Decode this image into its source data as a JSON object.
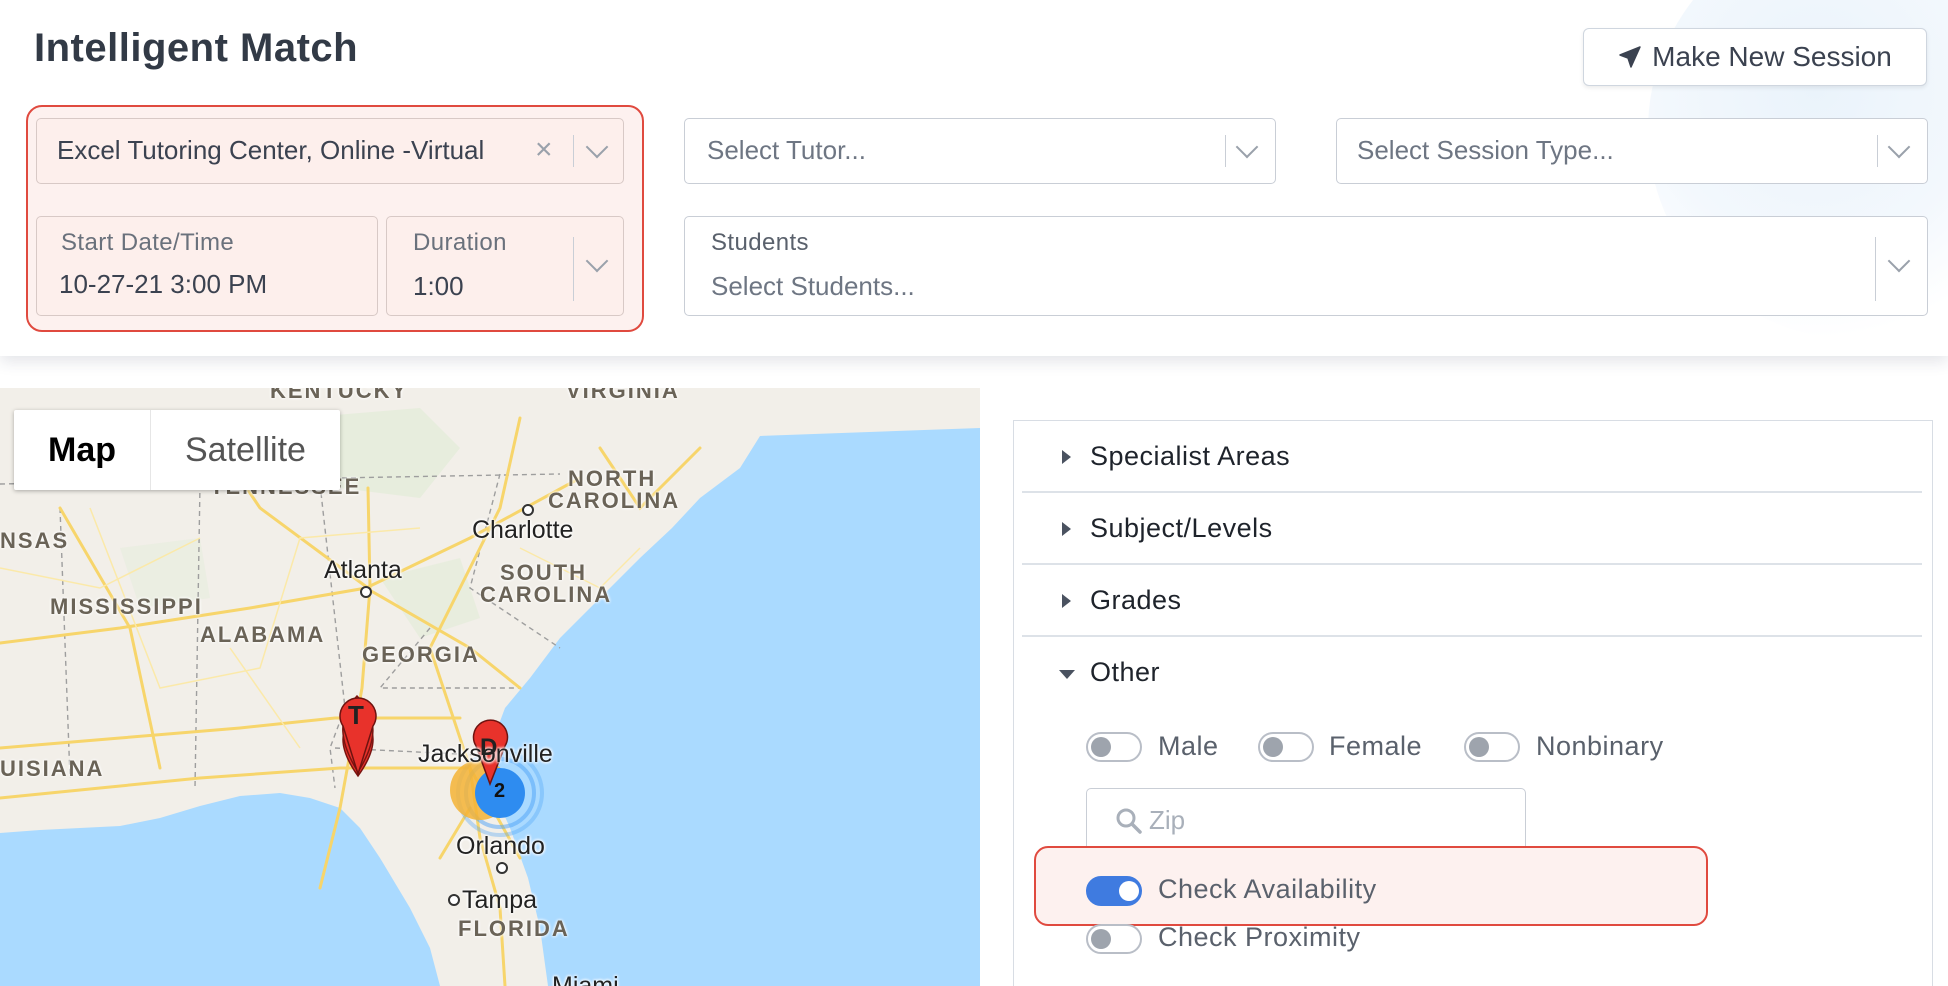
{
  "page": {
    "title": "Intelligent Match"
  },
  "header": {
    "make_session_label": "Make New Session",
    "make_session_icon": "paper-plane-icon"
  },
  "form": {
    "location": {
      "value": "Excel Tutoring Center, Online -Virtual"
    },
    "tutor": {
      "placeholder": "Select Tutor..."
    },
    "session_type": {
      "placeholder": "Select Session Type..."
    },
    "start": {
      "label": "Start Date/Time",
      "value": "10-27-21 3:00 PM"
    },
    "duration": {
      "label": "Duration",
      "value": "1:00"
    },
    "students": {
      "label": "Students",
      "placeholder": "Select Students..."
    }
  },
  "map": {
    "type_buttons": {
      "map": "Map",
      "satellite": "Satellite",
      "active": "Map"
    },
    "region_labels": {
      "kentucky": "KENTUCKY",
      "virginia": "VIRGINIA",
      "tennessee": "TENNESSEE",
      "north_carolina_1": "NORTH",
      "north_carolina_2": "CAROLINA",
      "south_carolina_1": "SOUTH",
      "south_carolina_2": "CAROLINA",
      "arkansas": "NSAS",
      "mississippi": "MISSISSIPPI",
      "alabama": "ALABAMA",
      "georgia": "GEORGIA",
      "louisiana": "UISIANA",
      "florida": "FLORIDA"
    },
    "cities": {
      "charlotte": "Charlotte",
      "atlanta": "Atlanta",
      "jacksonville": "Jacksonville",
      "orlando": "Orlando",
      "tampa": "Tampa",
      "miami": "Miami"
    },
    "markers": {
      "tutor": "T",
      "destination": "D",
      "cluster_count": "2"
    },
    "colors": {
      "water": "#aadaff",
      "land": "#f2efe9",
      "highway": "#f7d56b",
      "marker": "#e8322b",
      "cluster": "#2e8cf0"
    }
  },
  "filters": {
    "sections": [
      {
        "label": "Specialist Areas",
        "expanded": false
      },
      {
        "label": "Subject/Levels",
        "expanded": false
      },
      {
        "label": "Grades",
        "expanded": false
      },
      {
        "label": "Other",
        "expanded": true
      }
    ],
    "gender": {
      "male": {
        "label": "Male",
        "on": false
      },
      "female": {
        "label": "Female",
        "on": false
      },
      "nonbinary": {
        "label": "Nonbinary",
        "on": false
      }
    },
    "zip": {
      "placeholder": "Zip"
    },
    "check_availability": {
      "label": "Check Availability",
      "on": true
    },
    "check_proximity": {
      "label": "Check Proximity",
      "on": false
    }
  }
}
